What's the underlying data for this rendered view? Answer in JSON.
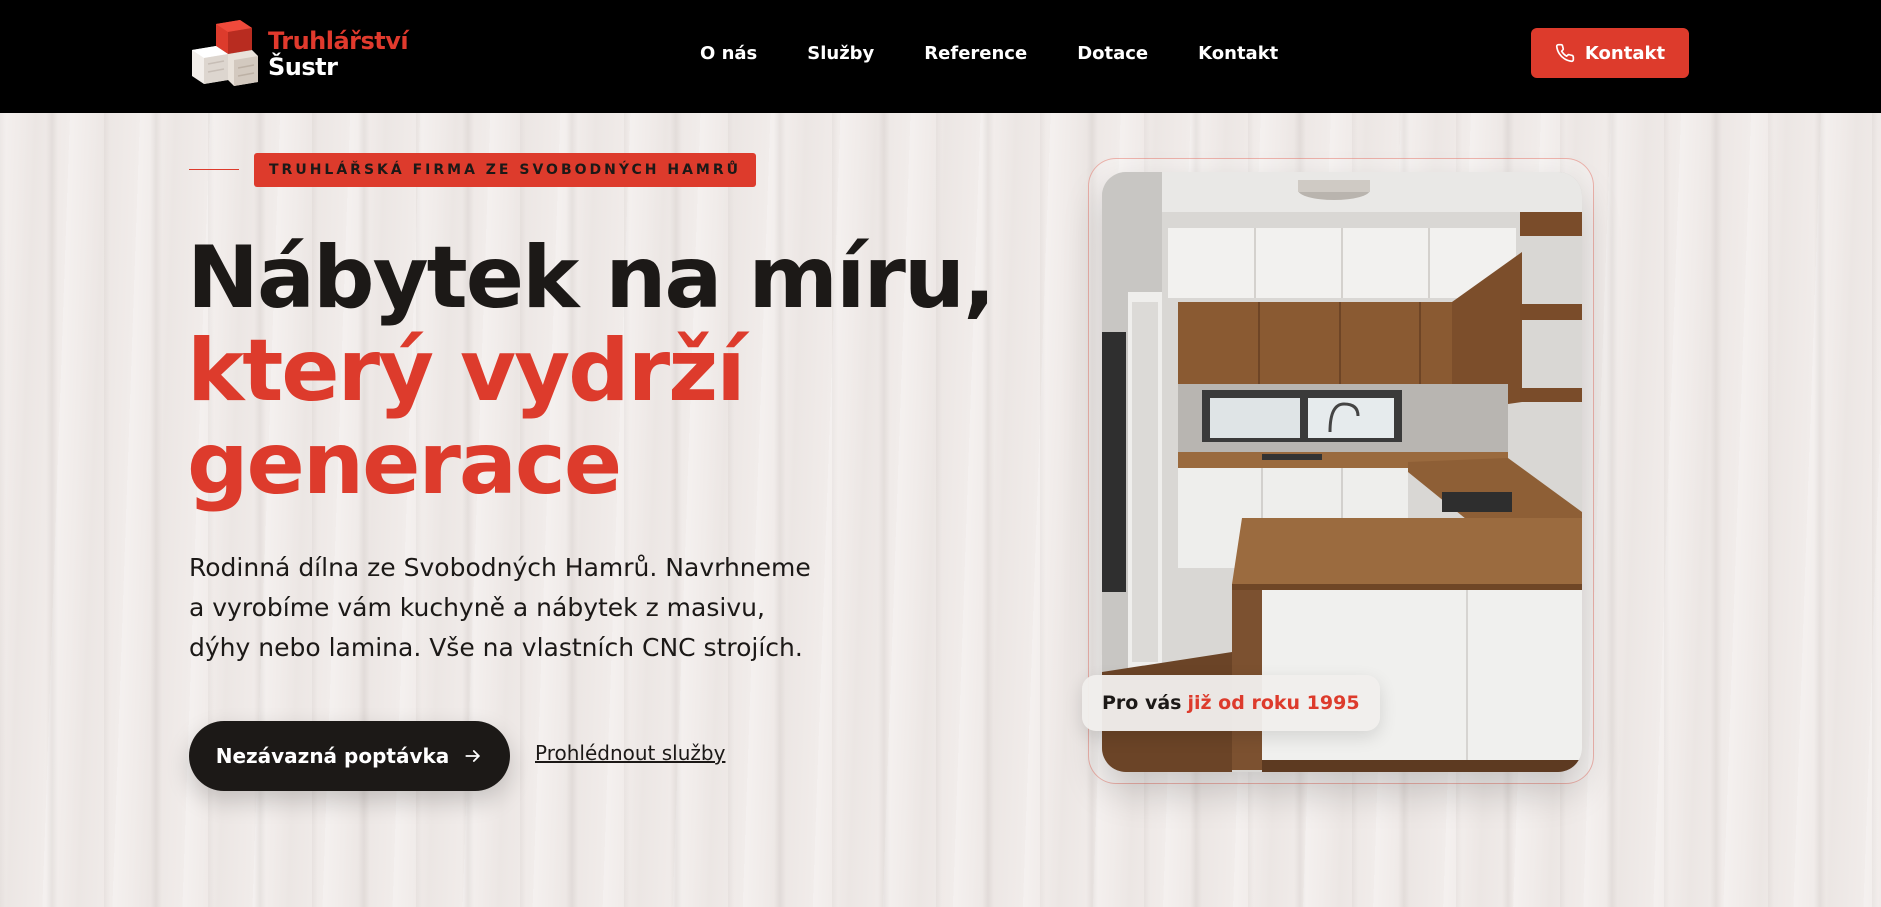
{
  "brand": {
    "line1": "Truhlářství",
    "line2": "Šustr"
  },
  "nav": {
    "items": [
      {
        "label": "O nás"
      },
      {
        "label": "Služby"
      },
      {
        "label": "Reference"
      },
      {
        "label": "Dotace"
      },
      {
        "label": "Kontakt"
      }
    ],
    "cta_label": "Kontakt"
  },
  "hero": {
    "eyebrow": "TRUHLÁŘSKÁ FIRMA ZE SVOBODNÝCH HAMRŮ",
    "title_line1": "Nábytek na míru,",
    "title_line2": "který vydrží",
    "title_line3": "generace",
    "lead": "Rodinná dílna ze Svobodných Hamrů. Navrhneme a vyrobíme vám kuchyně a nábytek z masivu, dýhy nebo lamina. Vše na vlastních CNC strojích.",
    "primary_cta": "Nezávazná poptávka",
    "secondary_cta": "Prohlédnout služby",
    "badge_prefix": "Pro vás",
    "badge_highlight": "již od roku 1995"
  },
  "colors": {
    "accent": "#dd3b2c",
    "dark": "#1c1917",
    "header_bg": "#000000"
  }
}
